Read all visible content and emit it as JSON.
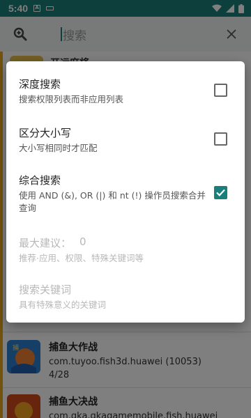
{
  "status_bar": {
    "time": "5:40",
    "notif_a": "A",
    "icons": [
      "wifi-icon",
      "signal-icon",
      "battery-icon"
    ]
  },
  "search": {
    "placeholder": "搜索",
    "zoom_icon": "zoom-search-icon",
    "clear_icon": "close-icon"
  },
  "list": {
    "behind_title": "开运麻将",
    "items": [
      {
        "name": "捕鱼大作战",
        "package": "com.tuyoo.fish3d.huawei (10053)",
        "count": "4/28"
      },
      {
        "name": "捕鱼大决战",
        "package": "com.qka.qkagamemobile.fish.huawei"
      }
    ]
  },
  "dialog": {
    "options": [
      {
        "title": "深度搜索",
        "desc": "搜索权限列表而非应用列表",
        "checked": false,
        "enabled": true
      },
      {
        "title": "区分大小写",
        "desc": "大小写相同时才匹配",
        "checked": false,
        "enabled": true
      },
      {
        "title": "综合搜索",
        "desc": "使用 AND (&), OR (|) 和 nt (!) 操作员搜索合并查询",
        "checked": true,
        "enabled": true
      },
      {
        "title": "最大建议：",
        "value": "0",
        "desc": "推荐·应用、权限、特殊关键词等",
        "enabled": false
      },
      {
        "title": "搜索关键词",
        "desc": "具有特殊意义的关键词",
        "enabled": false
      }
    ]
  },
  "colors": {
    "accent": "#1a7f7a",
    "list_accent": "#e5a51a"
  }
}
